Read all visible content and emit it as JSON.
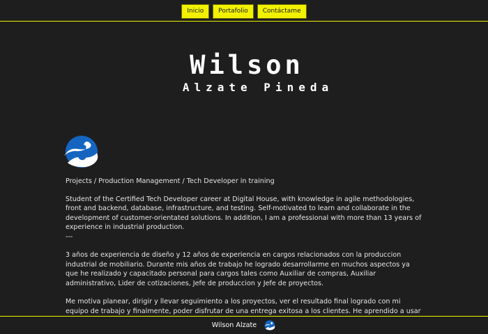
{
  "nav": {
    "items": [
      {
        "label": "Inicio"
      },
      {
        "label": "Portafolio"
      },
      {
        "label": "Contáctame"
      }
    ]
  },
  "hero": {
    "first_name": "Wilson",
    "last_name": "Alzate Pineda"
  },
  "about": {
    "tagline": "Projects / Production Management / Tech Developer in training",
    "paragraph_en": "Student of the Certified Tech Developer career at Digital House, with knowledge in agile methodologies, front and backend, database, infrastructure, and testing. Self-motivated to learn and collaborate in the development of customer-orientated solutions. In addition, I am a professional with more than 13 years of experience in industrial production.",
    "separator": "---",
    "paragraph_es_1": "3 años de experiencia de diseño y 12 años de experiencia en cargos relacionados con la produccion industrial de mobiliario. Durante mis años de trabajo he logrado desarrollarme en muchos aspectos ya que he realizado y capacitado personal para cargos tales como Auxiliar de compras, Auxiliar administrativo, Lider de cotizaciones, Jefe de produccion y Jefe de proyectos.",
    "paragraph_es_2": "Me motiva planear, dirigir y llevar seguimiento a los proyectos, ver el resultado final logrado con mi equipo de trabajo y finalmente, poder disfrutar de una entrega exitosa a los clientes. He aprendido a usar"
  },
  "footer": {
    "name": "Wilson Alzate"
  },
  "colors": {
    "background": "#1e1e1e",
    "accent": "#f2f200",
    "logo_blue": "#1565c0"
  },
  "icons": {
    "logo": "wa-logo-icon",
    "footer_logo": "wa-logo-icon"
  }
}
